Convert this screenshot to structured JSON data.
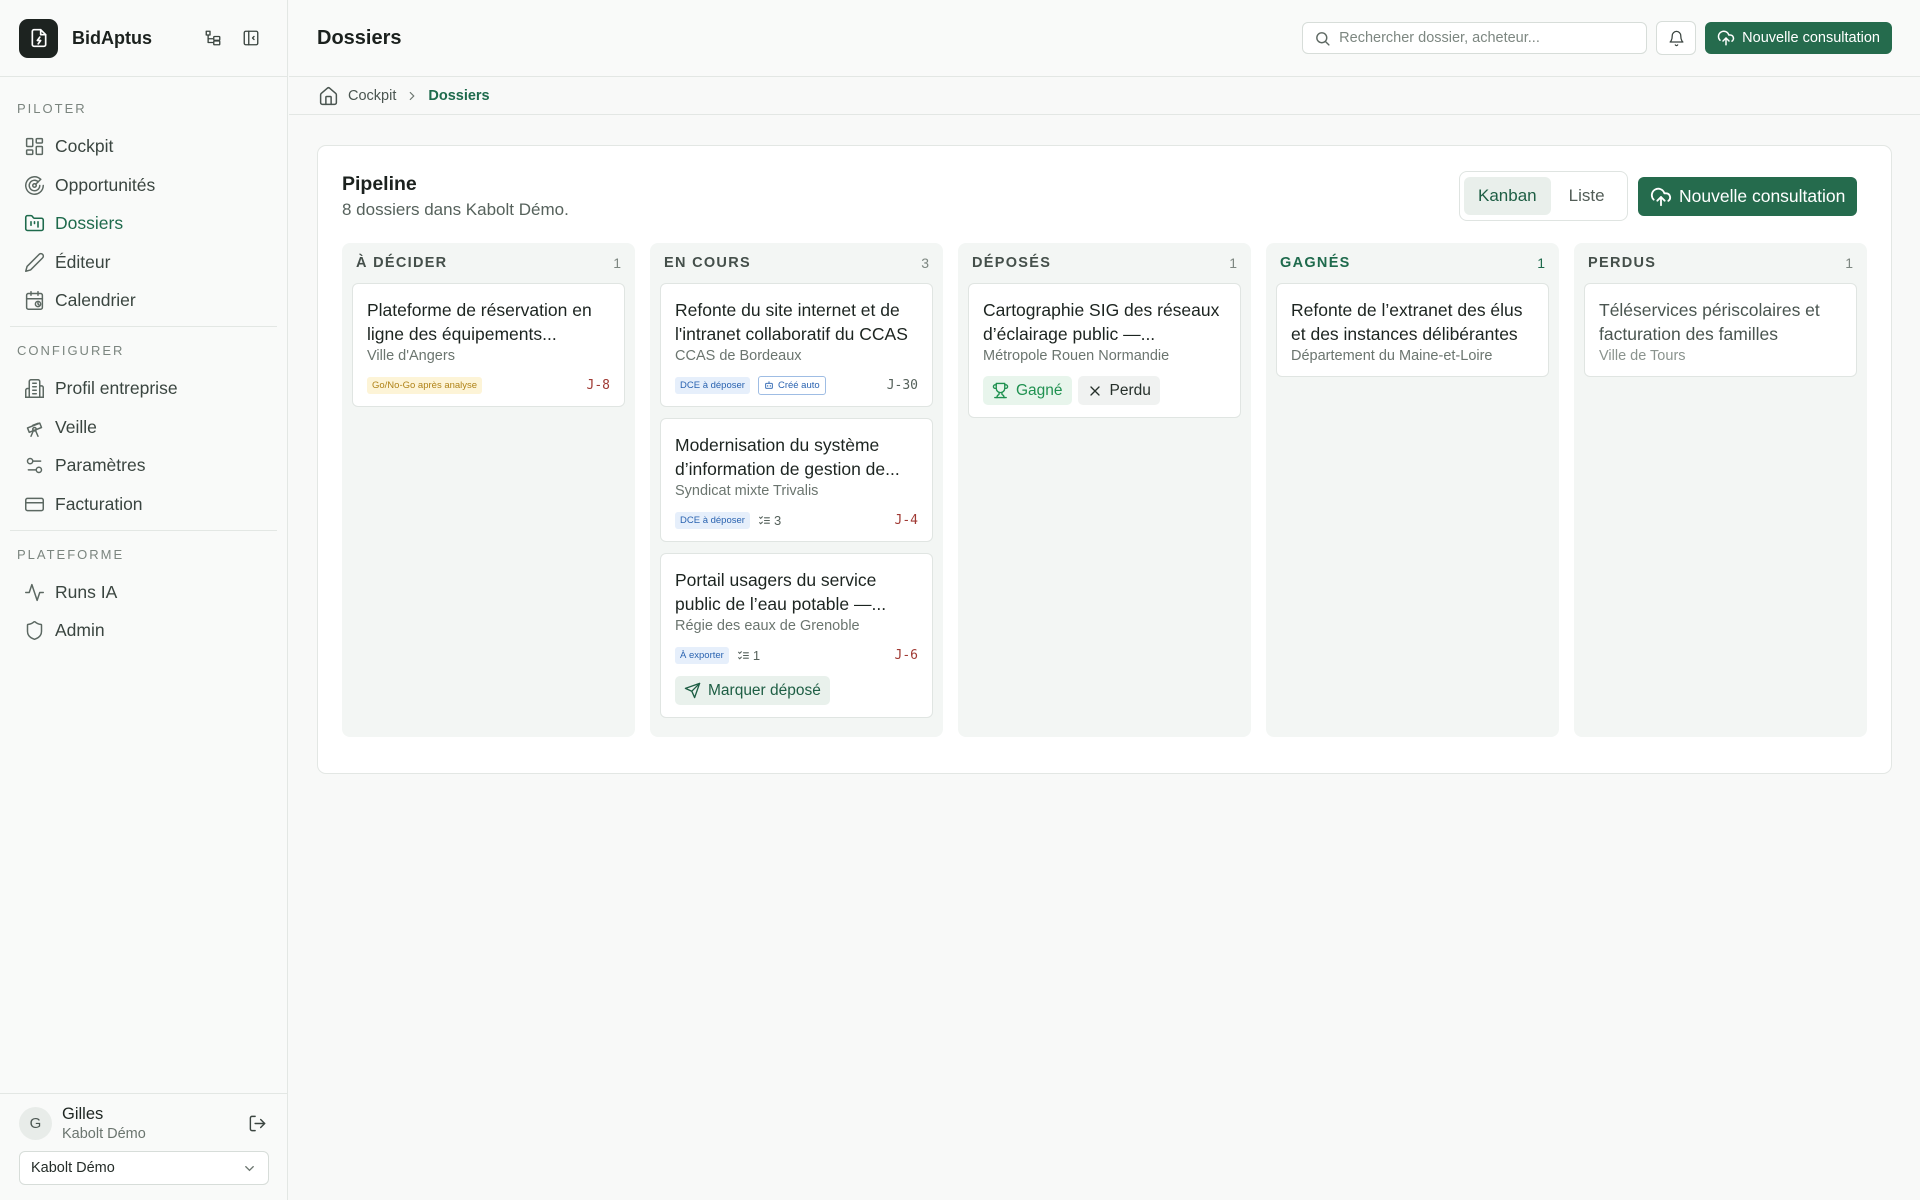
{
  "app": {
    "name": "BidAptus"
  },
  "sidebar": {
    "sections": [
      {
        "title": "PILOTER",
        "items": [
          {
            "label": "Cockpit",
            "icon": "grid-icon"
          },
          {
            "label": "Opportunités",
            "icon": "radar-icon"
          },
          {
            "label": "Dossiers",
            "icon": "folder-icon",
            "active": true
          },
          {
            "label": "Éditeur",
            "icon": "pen-icon"
          },
          {
            "label": "Calendrier",
            "icon": "calendar-icon"
          }
        ]
      },
      {
        "title": "CONFIGURER",
        "items": [
          {
            "label": "Profil entreprise",
            "icon": "building-icon"
          },
          {
            "label": "Veille",
            "icon": "telescope-icon"
          },
          {
            "label": "Paramètres",
            "icon": "sliders-icon"
          },
          {
            "label": "Facturation",
            "icon": "credit-card-icon"
          }
        ]
      },
      {
        "title": "PLATEFORME",
        "items": [
          {
            "label": "Runs IA",
            "icon": "activity-icon"
          },
          {
            "label": "Admin",
            "icon": "shield-icon"
          }
        ]
      }
    ],
    "user": {
      "initial": "G",
      "name": "Gilles",
      "org": "Kabolt Démo"
    },
    "org_select": "Kabolt Démo"
  },
  "topbar": {
    "title": "Dossiers",
    "search_placeholder": "Rechercher dossier, acheteur...",
    "new_button": "Nouvelle consultation"
  },
  "breadcrumb": {
    "home": "Cockpit",
    "current": "Dossiers"
  },
  "pipeline": {
    "title": "Pipeline",
    "subtitle": "8 dossiers dans Kabolt Démo.",
    "views": [
      "Kanban",
      "Liste"
    ],
    "active_view": "Kanban",
    "new_button": "Nouvelle consultation",
    "columns": [
      {
        "name": "À DÉCIDER",
        "count": "1",
        "cards": [
          {
            "title": "Plateforme de réservation en ligne des équipements...",
            "buyer": "Ville d'Angers",
            "badges": [
              {
                "text": "Go/No-Go après analyse",
                "style": "yellow"
              }
            ],
            "due": "J-8"
          }
        ]
      },
      {
        "name": "EN COURS",
        "count": "3",
        "cards": [
          {
            "title": "Refonte du site internet et de l'intranet collaboratif du CCAS",
            "buyer": "CCAS de Bordeaux",
            "badges": [
              {
                "text": "DCE à déposer",
                "style": "blue"
              },
              {
                "text": "Créé auto",
                "style": "outline",
                "icon": "bot-icon"
              }
            ],
            "due": "J-30",
            "due_style": "neutral"
          },
          {
            "title": "Modernisation du système d’information de gestion de...",
            "buyer": "Syndicat mixte Trivalis",
            "badges": [
              {
                "text": "DCE à déposer",
                "style": "blue"
              }
            ],
            "tasks": "3",
            "due": "J-4"
          },
          {
            "title": "Portail usagers du service public de l’eau potable —...",
            "buyer": "Régie des eaux de Grenoble",
            "badges": [
              {
                "text": "À exporter",
                "style": "blue"
              }
            ],
            "tasks": "1",
            "due": "J-6",
            "action": "Marquer déposé"
          }
        ]
      },
      {
        "name": "DÉPOSÉS",
        "count": "1",
        "cards": [
          {
            "title": "Cartographie SIG des réseaux d’éclairage public —...",
            "buyer": "Métropole Rouen Normandie",
            "outcome": {
              "win": "Gagné",
              "lost": "Perdu"
            }
          }
        ]
      },
      {
        "name": "GAGNÉS",
        "count": "1",
        "win": true,
        "cards": [
          {
            "title": "Refonte de l’extranet des élus et des instances délibérantes",
            "buyer": "Département du Maine-et-Loire"
          }
        ]
      },
      {
        "name": "PERDUS",
        "count": "1",
        "cards": [
          {
            "title": "Téléservices périscolaires et facturation des familles",
            "buyer": "Ville de Tours",
            "muted": true
          }
        ]
      }
    ]
  },
  "colors": {
    "accent": "#256b4d",
    "danger": "#a03a34",
    "win": "#1f9150"
  }
}
